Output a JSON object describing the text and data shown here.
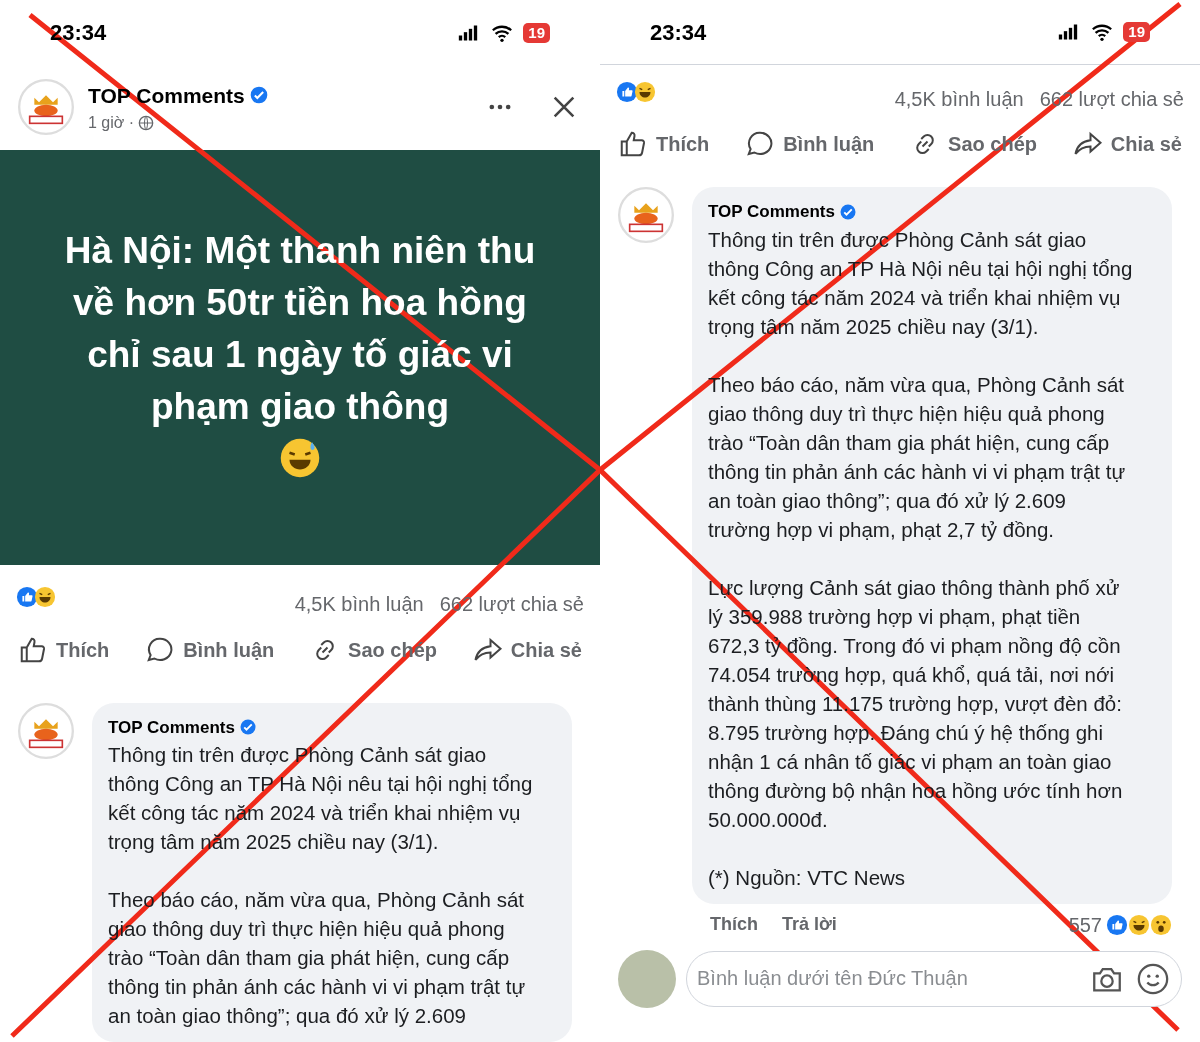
{
  "left_screen": {
    "status_bar": {
      "time": "23:34",
      "battery": "19"
    },
    "post": {
      "author": "TOP Comments",
      "verified": true,
      "time": "1 giờ ·",
      "headline": "Hà Nội: Một thanh niên thu về hơn 50tr tiền hoa hồng chỉ sau 1 ngày tố giác vi phạm giao thông"
    },
    "stats": {
      "comments": "4,5K bình luận",
      "shares": "662 lượt chia sẻ"
    },
    "actions": [
      "Thích",
      "Bình luận",
      "Sao chép",
      "Chia sẻ"
    ],
    "comment": {
      "author": "TOP Comments",
      "verified": true,
      "paragraphs": [
        "Thông tin trên được Phòng Cảnh sát giao thông Công an TP Hà Nội nêu tại hội nghị tổng kết công tác năm 2024 và triển khai nhiệm vụ trọng tâm năm 2025 chiều nay (3/1).",
        "Theo báo cáo, năm vừa qua, Phòng Cảnh sát giao thông duy trì thực hiện hiệu quả phong trào “Toàn dân tham gia phát hiện, cung cấp thông tin phản ánh các hành vi vi phạm trật tự an toàn giao thông”; qua đó xử lý 2.609"
      ]
    }
  },
  "right_screen": {
    "status_bar": {
      "time": "23:34",
      "battery": "19"
    },
    "stats": {
      "comments": "4,5K bình luận",
      "shares": "662 lượt chia sẻ"
    },
    "actions": [
      "Thích",
      "Bình luận",
      "Sao chép",
      "Chia sẻ"
    ],
    "comment": {
      "author": "TOP Comments",
      "verified": true,
      "paragraphs": [
        "Thông tin trên được Phòng Cảnh sát giao thông Công an TP Hà Nội nêu tại hội nghị tổng kết công tác năm 2024 và triển khai nhiệm vụ trọng tâm năm 2025 chiều nay (3/1).",
        "Theo báo cáo, năm vừa qua, Phòng Cảnh sát giao thông duy trì thực hiện hiệu quả phong trào “Toàn dân tham gia phát hiện, cung cấp thông tin phản ánh các hành vi vi phạm trật tự an toàn giao thông”; qua đó xử lý 2.609 trường hợp vi phạm, phạt 2,7 tỷ đồng.",
        "Lực lượng Cảnh sát giao thông thành phố xử lý 359.988 trường hợp vi phạm, phạt tiền 672,3 tỷ đồng. Trong đó vi phạm nồng độ cồn 74.054 trường hợp, quá khổ, quá tải, nơi nới thành thùng 11.175 trường hợp, vượt đèn đỏ: 8.795 trường hợp. Đáng chú ý hệ thống ghi nhận 1 cá nhân tố giác vi phạm an toàn giao thông đường bộ nhận hoa hồng ước tính hơn 50.000.000đ.",
        "(*) Nguồn: VTC News"
      ],
      "links": [
        "Thích",
        "Trả lời"
      ],
      "reaction_count": "557"
    },
    "reply_field": {
      "placeholder": "Bình luận dưới tên Đức Thuận"
    }
  }
}
